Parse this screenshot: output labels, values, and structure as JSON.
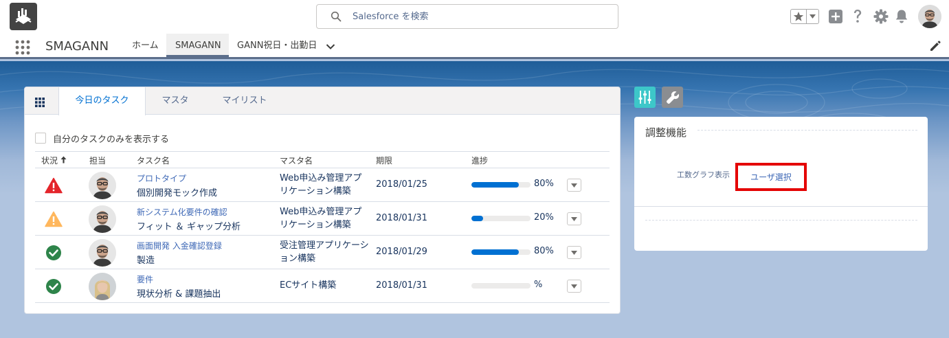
{
  "header": {
    "search": {
      "placeholder": "Salesforce を検索"
    }
  },
  "nav": {
    "app_name": "SMAGANN",
    "items": [
      {
        "label": "ホーム"
      },
      {
        "label": "SMAGANN",
        "active": true
      },
      {
        "label": "GANN祝日・出勤日"
      }
    ]
  },
  "task_card": {
    "tabs": [
      {
        "label": "今日のタスク",
        "active": true
      },
      {
        "label": "マスタ"
      },
      {
        "label": "マイリスト"
      }
    ],
    "filter_label": "自分のタスクのみを表示する",
    "columns": [
      "状況",
      "担当",
      "タスク名",
      "マスタ名",
      "期限",
      "進捗"
    ],
    "rows": [
      {
        "status": "error",
        "task_link": "プロトタイプ",
        "task_sub": "個別開発モック作成",
        "master": "Web申込み管理アプリケーション構築",
        "due": "2018/01/25",
        "progress": 80,
        "progress_label": "80%"
      },
      {
        "status": "warning",
        "task_link": "新システム化要件の確認",
        "task_sub": "フィット ＆ ギャップ分析",
        "master": "Web申込み管理アプリケーション構築",
        "due": "2018/01/31",
        "progress": 20,
        "progress_label": "20%"
      },
      {
        "status": "success",
        "task_link": "画面開発 入金確認登録",
        "task_sub": "製造",
        "master": "受注管理アプリケーション構築",
        "due": "2018/01/29",
        "progress": 80,
        "progress_label": "80%"
      },
      {
        "status": "success",
        "task_link": "要件",
        "task_sub": "現状分析 & 課題抽出",
        "master": "ECサイト構築",
        "due": "2018/01/31",
        "progress": 0,
        "progress_label": "%"
      }
    ]
  },
  "adjust_panel": {
    "title": "調整機能",
    "label": "工数グラフ表示",
    "button_label": "ユーザ選択"
  },
  "colors": {
    "brand": "#0070d2",
    "error": "#e4252b",
    "warning": "#ffb75d",
    "success": "#2e844a",
    "highlight": "#e40000"
  }
}
